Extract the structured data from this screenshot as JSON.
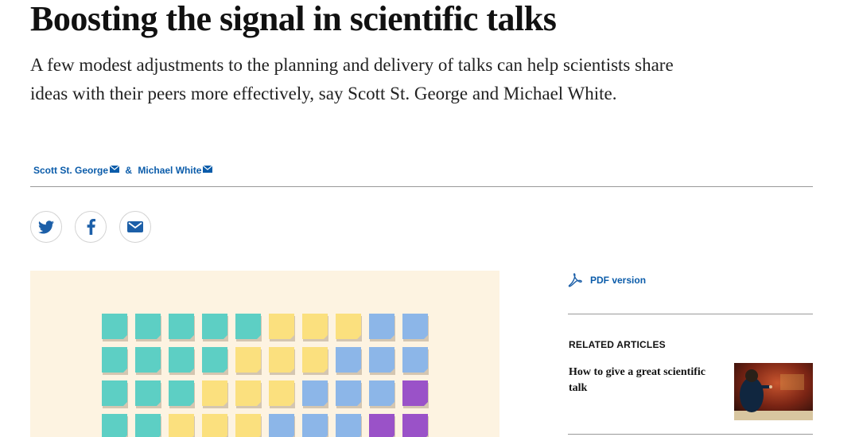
{
  "article": {
    "title": "Boosting the signal in scientific talks",
    "standfirst": "A few modest adjustments to the planning and delivery of talks can help scientists share ideas with their peers more effectively, say Scott St. George and Michael White.",
    "authors": [
      {
        "name": "Scott St. George"
      },
      {
        "name": "Michael White"
      }
    ],
    "author_separator": "&"
  },
  "share": [
    {
      "icon": "twitter-icon"
    },
    {
      "icon": "facebook-icon"
    },
    {
      "icon": "email-icon"
    }
  ],
  "figure": {
    "background": "#fdf3e1",
    "note_colors": {
      "teal": "#5dcfc4",
      "yellow": "#fbe07e",
      "blue": "#8cb6e8",
      "purple": "#9a52c8",
      "shadow": "#b2a08b"
    },
    "rows": [
      [
        "teal",
        "teal",
        "teal",
        "teal",
        "teal",
        "yellow",
        "yellow",
        "yellow",
        "blue",
        "blue"
      ],
      [
        "teal",
        "teal",
        "teal",
        "teal",
        "yellow",
        "yellow",
        "yellow",
        "blue",
        "blue",
        "blue"
      ],
      [
        "teal",
        "teal",
        "teal",
        "yellow",
        "yellow",
        "yellow",
        "blue",
        "blue",
        "blue",
        "purple"
      ],
      [
        "teal",
        "teal",
        "yellow",
        "yellow",
        "yellow",
        "blue",
        "blue",
        "blue",
        "purple",
        "purple"
      ]
    ]
  },
  "sidebar": {
    "pdf_label": "PDF version",
    "related_heading": "RELATED ARTICLES",
    "related": [
      {
        "title": "How to give a great scientific talk"
      }
    ]
  },
  "colors": {
    "link": "#0b5caa",
    "text": "#111111"
  }
}
